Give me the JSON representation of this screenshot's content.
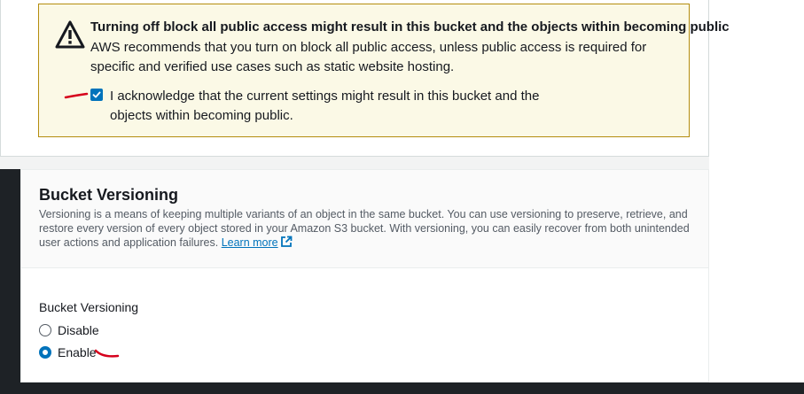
{
  "alert": {
    "icon": "warning-triangle-icon",
    "title": "Turning off block all public access might result in this bucket and the objects within becoming public",
    "message": "AWS recommends that you turn on block all public access, unless public access is required for specific and verified use cases such as static website hosting.",
    "acknowledge": {
      "checked": true,
      "label": "I acknowledge that the current settings might result in this bucket and the objects within becoming public."
    }
  },
  "versioning": {
    "title": "Bucket Versioning",
    "description": "Versioning is a means of keeping multiple variants of an object in the same bucket. You can use versioning to preserve, retrieve, and restore every version of every object stored in your Amazon S3 bucket. With versioning, you can easily recover from both unintended user actions and application failures.",
    "learn_more": "Learn more",
    "field_label": "Bucket Versioning",
    "options": [
      {
        "label": "Disable",
        "selected": false
      },
      {
        "label": "Enable",
        "selected": true
      }
    ]
  },
  "colors": {
    "accent": "#0073bb",
    "alert_border": "#b48d0e",
    "alert_bg": "#fbf9e6",
    "annotation": "#d6001c"
  }
}
